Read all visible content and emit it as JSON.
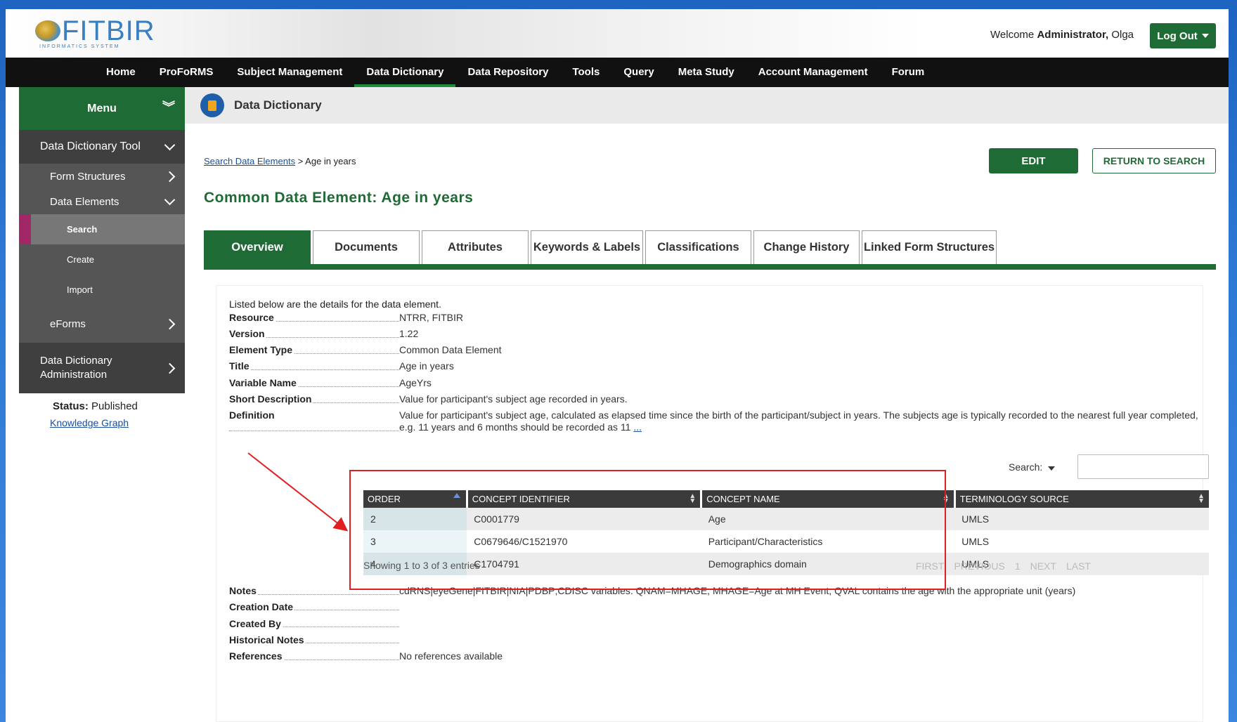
{
  "header": {
    "logo_text": "FITBIR",
    "logo_subtitle": "INFORMATICS SYSTEM",
    "welcome_prefix": "Welcome",
    "user_role": "Administrator,",
    "user_name": "Olga",
    "logout_label": "Log Out"
  },
  "nav": {
    "items": [
      "Home",
      "ProFoRMS",
      "Subject Management",
      "Data Dictionary",
      "Data Repository",
      "Tools",
      "Query",
      "Meta Study",
      "Account Management",
      "Forum"
    ],
    "active_index": 3
  },
  "sidebar": {
    "menu_label": "Menu",
    "items": [
      {
        "label": "Data Dictionary Tool"
      },
      {
        "label": "Form Structures"
      },
      {
        "label": "Data Elements"
      },
      {
        "label": "Search"
      },
      {
        "label": "Create"
      },
      {
        "label": "Import"
      },
      {
        "label": "eForms"
      },
      {
        "label": "Data Dictionary Administration"
      }
    ],
    "status_label": "Status:",
    "status_value": "Published",
    "knowledge_graph_link": "Knowledge Graph"
  },
  "main": {
    "section_title": "Data Dictionary",
    "breadcrumb_link": "Search Data Elements",
    "breadcrumb_current": " > Age in years",
    "edit_label": "EDIT",
    "return_label": "RETURN TO SEARCH",
    "page_title": "Common Data Element: Age in years",
    "tabs": [
      "Overview",
      "Documents",
      "Attributes",
      "Keywords & Labels",
      "Classifications",
      "Change History",
      "Linked Form Structures"
    ],
    "active_tab": 0,
    "intro": "Listed below are the details for the data element.",
    "details": [
      {
        "label": "Resource",
        "value": "NTRR, FITBIR"
      },
      {
        "label": "Version",
        "value": "1.22"
      },
      {
        "label": "Element Type",
        "value": "Common Data Element"
      },
      {
        "label": "Title",
        "value": "Age in years"
      },
      {
        "label": "Variable Name",
        "value": "AgeYrs"
      },
      {
        "label": "Short Description",
        "value": "Value for participant's subject age recorded in years."
      },
      {
        "label": "Definition",
        "value": "Value for participant's subject age, calculated as elapsed time since the birth of the participant/subject in years. The subjects age is typically recorded to the nearest full year completed, e.g. 11 years and 6 months should be recorded as 11 ",
        "more": "..."
      }
    ],
    "details_after": [
      {
        "label": "Notes",
        "value": "cdRNS|eyeGene|FITBIR|NIA|PDBP;CDISC variables: QNAM=MHAGE, MHAGE=Age at MH Event, QVAL contains the age with the appropriate unit (years)"
      },
      {
        "label": "Creation Date",
        "value": ""
      },
      {
        "label": "Created By",
        "value": ""
      },
      {
        "label": "Historical Notes",
        "value": ""
      },
      {
        "label": "References",
        "value": "No references available"
      }
    ],
    "search_label": "Search:",
    "table": {
      "columns": [
        "ORDER",
        "CONCEPT IDENTIFIER",
        "CONCEPT NAME",
        "TERMINOLOGY SOURCE"
      ],
      "rows": [
        [
          "2",
          "C0001779",
          "Age",
          "UMLS"
        ],
        [
          "3",
          "C0679646/C1521970",
          "Participant/Characteristics",
          "UMLS"
        ],
        [
          "4",
          "C1704791",
          "Demographics domain",
          "UMLS"
        ]
      ],
      "showing": "Showing 1 to 3 of 3 entries",
      "pager": [
        "FIRST",
        "PREVIOUS",
        "1",
        "NEXT",
        "LAST"
      ]
    }
  },
  "colors": {
    "brand_green": "#1e6b35",
    "nav_black": "#111111",
    "highlight_red": "#e02020"
  }
}
